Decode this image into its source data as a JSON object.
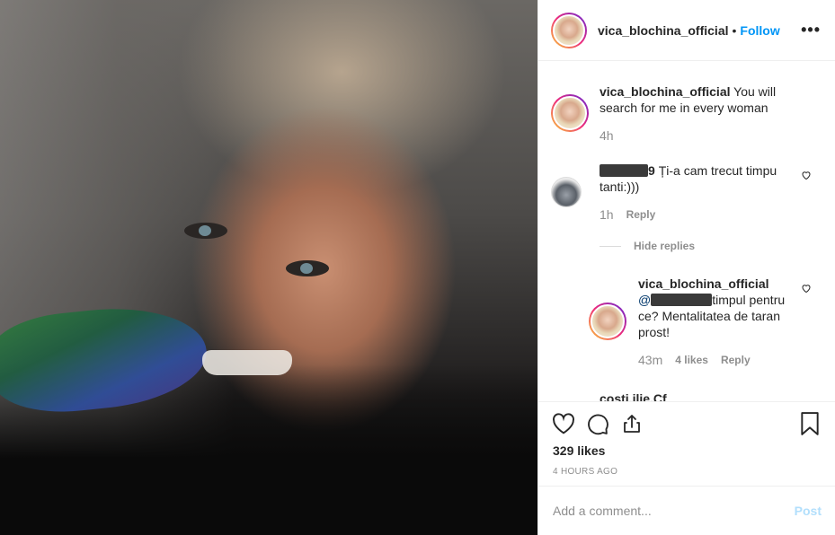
{
  "header": {
    "username": "vica_blochina_official",
    "separator": "•",
    "follow_label": "Follow",
    "more_label": "•••"
  },
  "caption": {
    "username": "vica_blochina_official",
    "text": "You will search for me in every woman",
    "time": "4h"
  },
  "comments": [
    {
      "username_redacted": true,
      "username_visible_suffix": "9",
      "text": "Ți-a cam trecut timpu tanti:)))",
      "time": "1h",
      "reply_label": "Reply",
      "hide_replies_label": "Hide replies"
    }
  ],
  "reply": {
    "username": "vica_blochina_official",
    "mention_prefix": "@",
    "text": "timpul pentru ce? Mentalitatea de taran prost!",
    "time": "43m",
    "likes_label": "4 likes",
    "reply_label": "Reply"
  },
  "next_comment_partial": "costi.ilie.Cf",
  "footer": {
    "likes": "329 likes",
    "posted_ago": "4 HOURS AGO",
    "add_comment_placeholder": "Add a comment...",
    "post_label": "Post"
  },
  "icons": [
    "heart-icon",
    "comment-icon",
    "share-icon",
    "bookmark-icon"
  ],
  "colors": {
    "link_blue": "#0095f6",
    "post_disabled": "#b2dffc",
    "muted": "#8e8e8e"
  }
}
